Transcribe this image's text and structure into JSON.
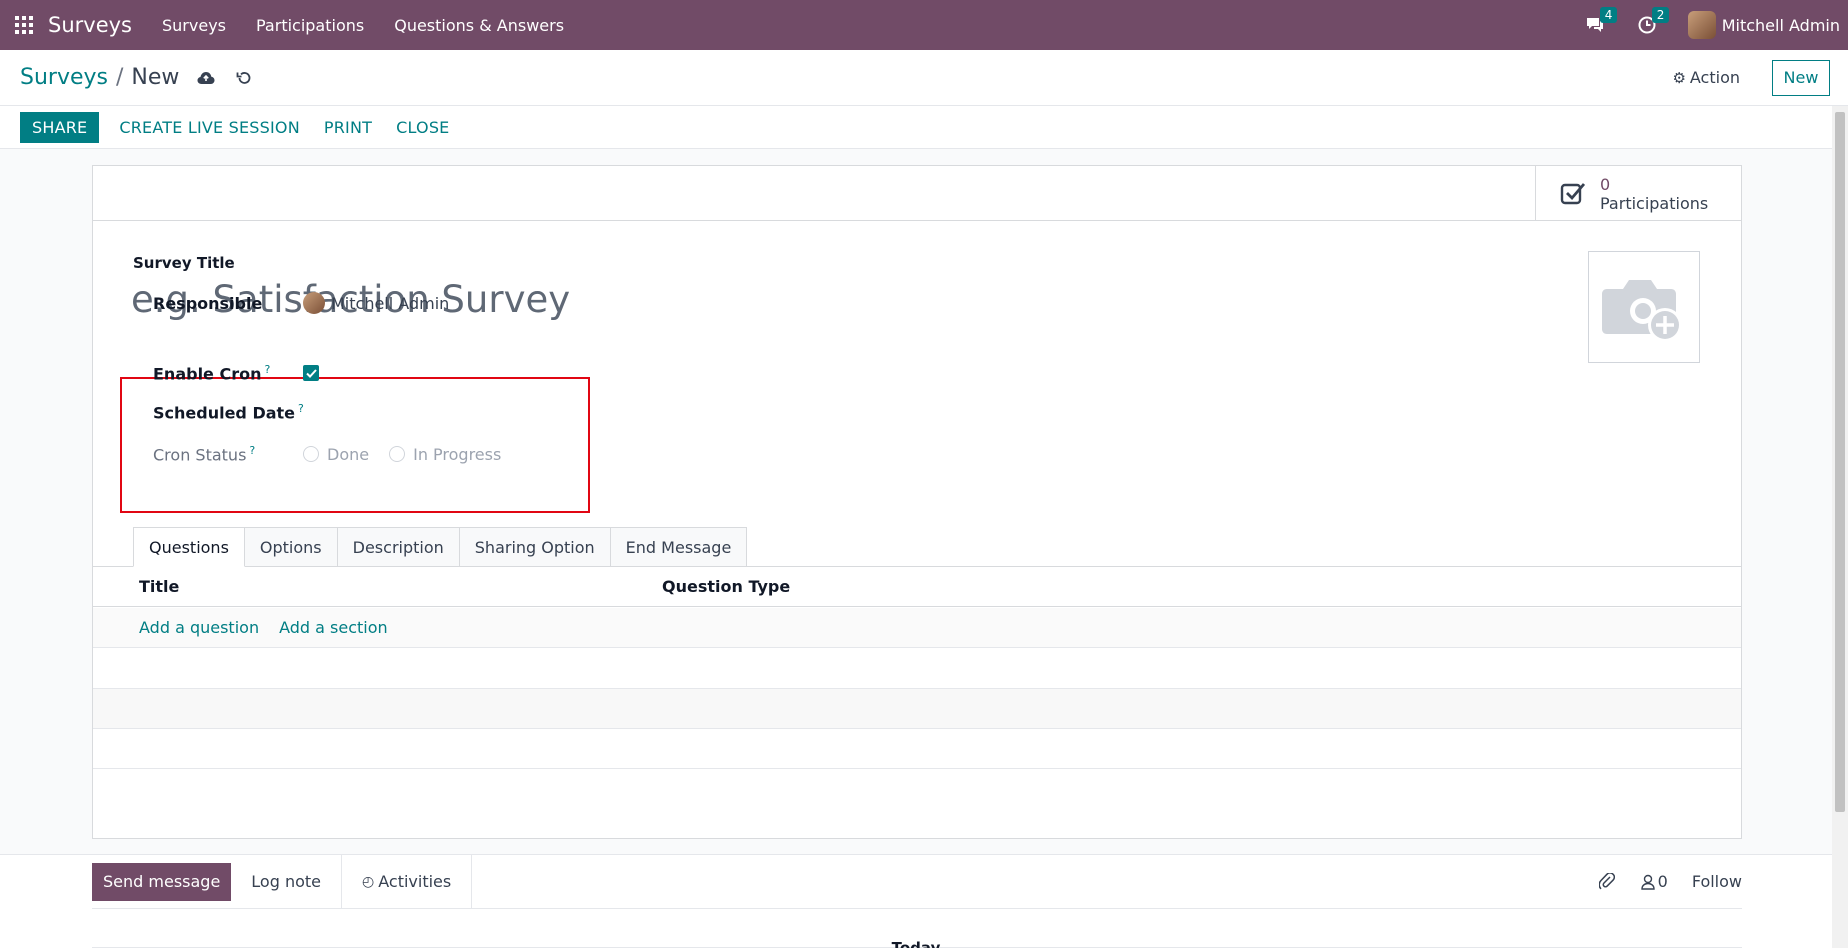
{
  "navbar": {
    "brand": "Surveys",
    "menu": [
      "Surveys",
      "Participations",
      "Questions & Answers"
    ],
    "messages_count": "4",
    "activities_count": "2",
    "user_name": "Mitchell Admin"
  },
  "control": {
    "breadcrumb_parent": "Surveys",
    "breadcrumb_sep": "/",
    "breadcrumb_current": "New",
    "action_label": "Action",
    "new_label": "New"
  },
  "statusbar": {
    "share_label": "SHARE",
    "buttons": [
      "CREATE LIVE SESSION",
      "PRINT",
      "CLOSE"
    ]
  },
  "stat_button": {
    "value": "0",
    "label": "Participations"
  },
  "form": {
    "title_label": "Survey Title",
    "title_placeholder": "e.g. Satisfaction Survey",
    "responsible_label": "Responsible",
    "responsible_value": "Mitchell Admin",
    "enable_cron_label": "Enable Cron",
    "enable_cron_checked": true,
    "scheduled_date_label": "Scheduled Date",
    "cron_status_label": "Cron Status",
    "cron_status_options": [
      "Done",
      "In Progress"
    ],
    "help_mark": "?"
  },
  "tabs": [
    "Questions",
    "Options",
    "Description",
    "Sharing Option",
    "End Message"
  ],
  "questions_table": {
    "columns": [
      "Title",
      "Question Type"
    ],
    "add_question": "Add a question",
    "add_section": "Add a section"
  },
  "chatter": {
    "send_message": "Send message",
    "log_note": "Log note",
    "activities": "Activities",
    "followers_count": "0",
    "follow": "Follow",
    "today": "Today"
  },
  "colors": {
    "brand": "#714b67",
    "accent": "#017e84",
    "highlight": "#e10613"
  }
}
